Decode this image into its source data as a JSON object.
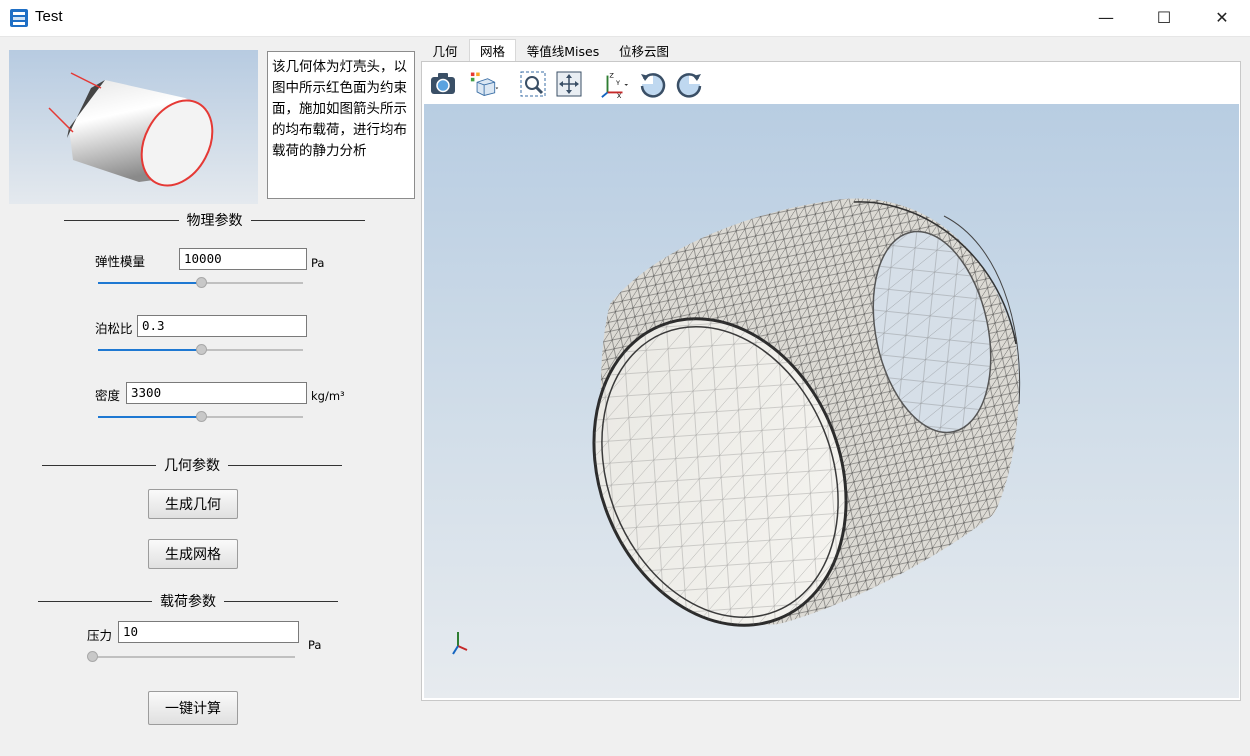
{
  "window": {
    "title": "Test",
    "minimize_glyph": "—",
    "maximize_glyph": "☐",
    "close_glyph": "✕"
  },
  "description": "该几何体为灯壳头，以图中所示红色面为约束面，施加如图箭头所示的均布载荷，进行均布载荷的静力分析",
  "physics": {
    "section_title": "物理参数",
    "modulus_label": "弹性模量",
    "modulus_value": "10000",
    "modulus_unit": "Pa",
    "modulus_slider": 0.5,
    "poisson_label": "泊松比",
    "poisson_value": "0.3",
    "poisson_slider": 0.5,
    "density_label": "密度",
    "density_value": "3300",
    "density_unit": "kg/m³",
    "density_slider": 0.5
  },
  "geometry": {
    "section_title": "几何参数",
    "gen_geometry": "生成几何",
    "gen_mesh": "生成网格"
  },
  "load": {
    "section_title": "载荷参数",
    "pressure_label": "压力",
    "pressure_value": "10",
    "pressure_unit": "Pa",
    "pressure_slider": 0.0,
    "compute": "一键计算"
  },
  "tabs": [
    {
      "label": "几何",
      "active": false
    },
    {
      "label": "网格",
      "active": true
    },
    {
      "label": "等值线Mises",
      "active": false
    },
    {
      "label": "位移云图",
      "active": false
    }
  ],
  "toolbar": [
    "camera-icon",
    "view-cube-icon",
    "zoom-box-icon",
    "fit-all-icon",
    "axes-icon",
    "rotate-cw-icon",
    "rotate-ccw-icon"
  ],
  "colors": {
    "constraint_face": "#e53935",
    "slider_fill": "#1e78d2"
  }
}
